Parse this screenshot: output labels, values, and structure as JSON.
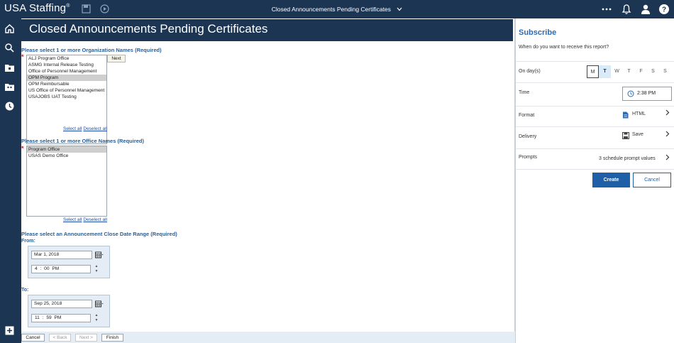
{
  "topbar": {
    "brand": "USA Staffing",
    "brand_mark": "®",
    "report_title": "Closed Announcements Pending Certificates"
  },
  "page": {
    "title": "Closed Announcements Pending Certificates"
  },
  "org_section": {
    "label": "Please select 1 or more Organization Names (Required)",
    "items": [
      {
        "label": "ALJ Program Office",
        "selected": false
      },
      {
        "label": "ASMG Internal Release Testing",
        "selected": false
      },
      {
        "label": "Office of Personnel Management",
        "selected": false
      },
      {
        "label": "OPM Program",
        "selected": true
      },
      {
        "label": "OPM Reimbursable",
        "selected": false
      },
      {
        "label": "US Office of Personnel Management",
        "selected": false
      },
      {
        "label": "USAJOBS UAT Testing",
        "selected": false
      }
    ],
    "next_label": "Next",
    "select_all": "Select all",
    "deselect_all": "Deselect all"
  },
  "office_section": {
    "label": "Please select 1 or more Office Names (Required)",
    "items": [
      {
        "label": "Program Office",
        "selected": true
      },
      {
        "label": "USAS Demo Office",
        "selected": false
      }
    ],
    "select_all": "Select all",
    "deselect_all": "Deselect all"
  },
  "date_section": {
    "label": "Please select an Announcement Close Date Range (Required)",
    "from": {
      "label": "From:",
      "date": "Mar 1, 2018",
      "time": "4 : 00  PM"
    },
    "to": {
      "label": "To:",
      "date": "Sep 25, 2018",
      "time": "11 : 59  PM"
    }
  },
  "footer": {
    "cancel": "Cancel",
    "back": "< Back",
    "next": "Next >",
    "finish": "Finish"
  },
  "subscribe": {
    "title": "Subscribe",
    "question": "When do you want to receive this report?",
    "on_days_label": "On day(s)",
    "days": [
      "M",
      "T",
      "W",
      "T",
      "F",
      "S",
      "S"
    ],
    "time_label": "Time",
    "time_value": "2:38 PM",
    "format_label": "Format",
    "format_value": "HTML",
    "delivery_label": "Delivery",
    "delivery_value": "Save",
    "prompts_label": "Prompts",
    "prompts_value": "3 schedule prompt values",
    "create": "Create",
    "cancel": "Cancel"
  },
  "colors": {
    "navy": "#1b3552",
    "accent_blue": "#1f5fa8",
    "label_blue": "#2b5f98"
  }
}
